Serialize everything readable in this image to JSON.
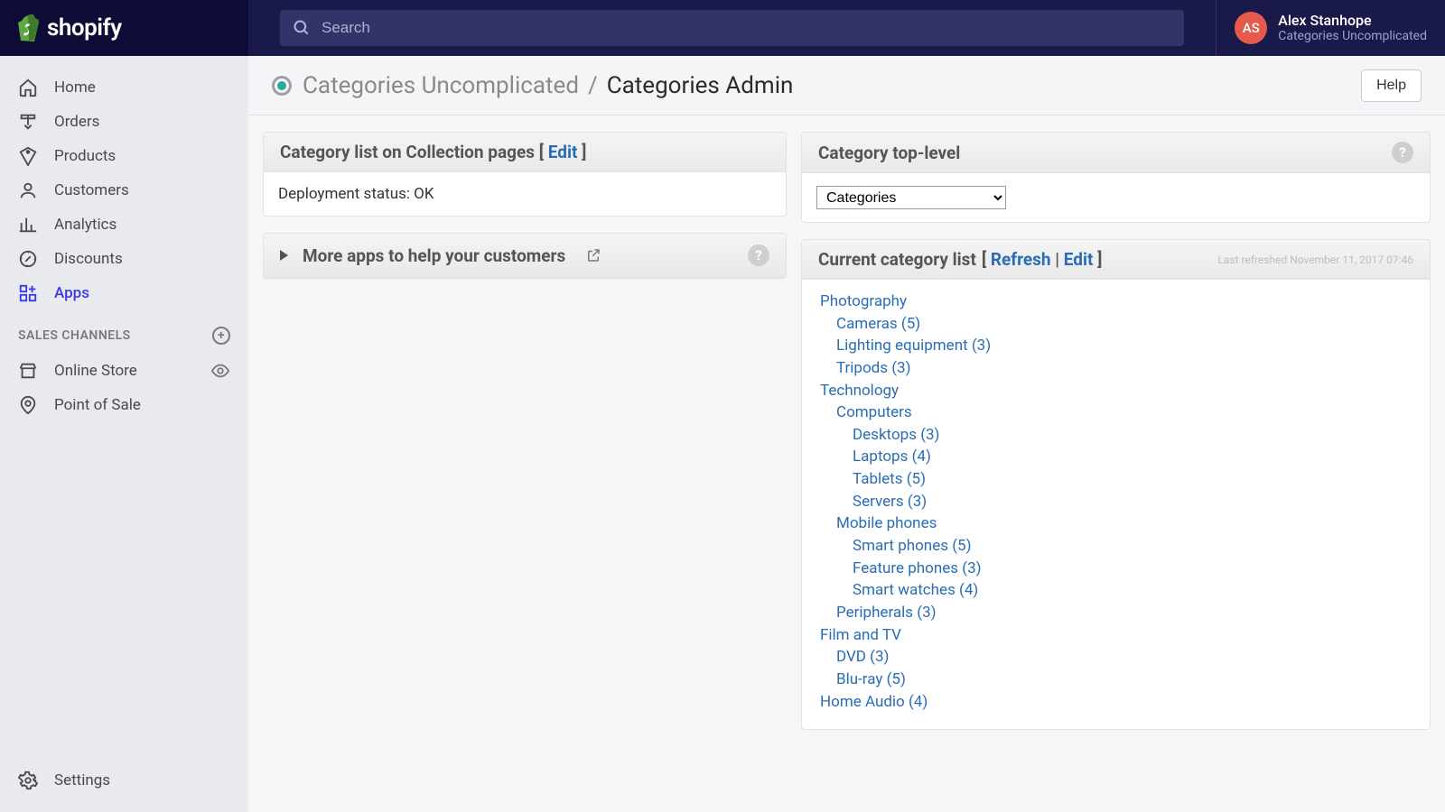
{
  "brand": "shopify",
  "search": {
    "placeholder": "Search"
  },
  "user": {
    "initials": "AS",
    "name": "Alex Stanhope",
    "store": "Categories Uncomplicated"
  },
  "sidebar": {
    "items": [
      {
        "label": "Home"
      },
      {
        "label": "Orders"
      },
      {
        "label": "Products"
      },
      {
        "label": "Customers"
      },
      {
        "label": "Analytics"
      },
      {
        "label": "Discounts"
      },
      {
        "label": "Apps"
      }
    ],
    "sales_header": "SALES CHANNELS",
    "channels": [
      {
        "label": "Online Store"
      },
      {
        "label": "Point of Sale"
      }
    ],
    "settings": "Settings"
  },
  "breadcrumb": {
    "app": "Categories Uncomplicated",
    "page": "Categories Admin"
  },
  "help": "Help",
  "panels": {
    "p1_title": "Category list on Collection pages",
    "p1_edit": "Edit",
    "p1_status": "Deployment status: OK",
    "p2_title": "More apps to help your customers",
    "p3_title": "Category top-level",
    "p3_select": "Categories",
    "p4_title": "Current category list",
    "p4_refresh": "Refresh",
    "p4_edit": "Edit",
    "p4_last": "Last refreshed November 11, 2017 07:46"
  },
  "tree": [
    {
      "label": "Photography",
      "children": [
        {
          "label": "Cameras (5)"
        },
        {
          "label": "Lighting equipment (3)"
        },
        {
          "label": "Tripods (3)"
        }
      ]
    },
    {
      "label": "Technology",
      "children": [
        {
          "label": "Computers",
          "children": [
            {
              "label": "Desktops (3)"
            },
            {
              "label": "Laptops (4)"
            },
            {
              "label": "Tablets (5)"
            },
            {
              "label": "Servers (3)"
            }
          ]
        },
        {
          "label": "Mobile phones",
          "children": [
            {
              "label": "Smart phones (5)"
            },
            {
              "label": "Feature phones (3)"
            },
            {
              "label": "Smart watches (4)"
            }
          ]
        },
        {
          "label": "Peripherals (3)"
        }
      ]
    },
    {
      "label": "Film and TV",
      "children": [
        {
          "label": "DVD (3)"
        },
        {
          "label": "Blu-ray (5)"
        }
      ]
    },
    {
      "label": "Home Audio (4)"
    }
  ]
}
